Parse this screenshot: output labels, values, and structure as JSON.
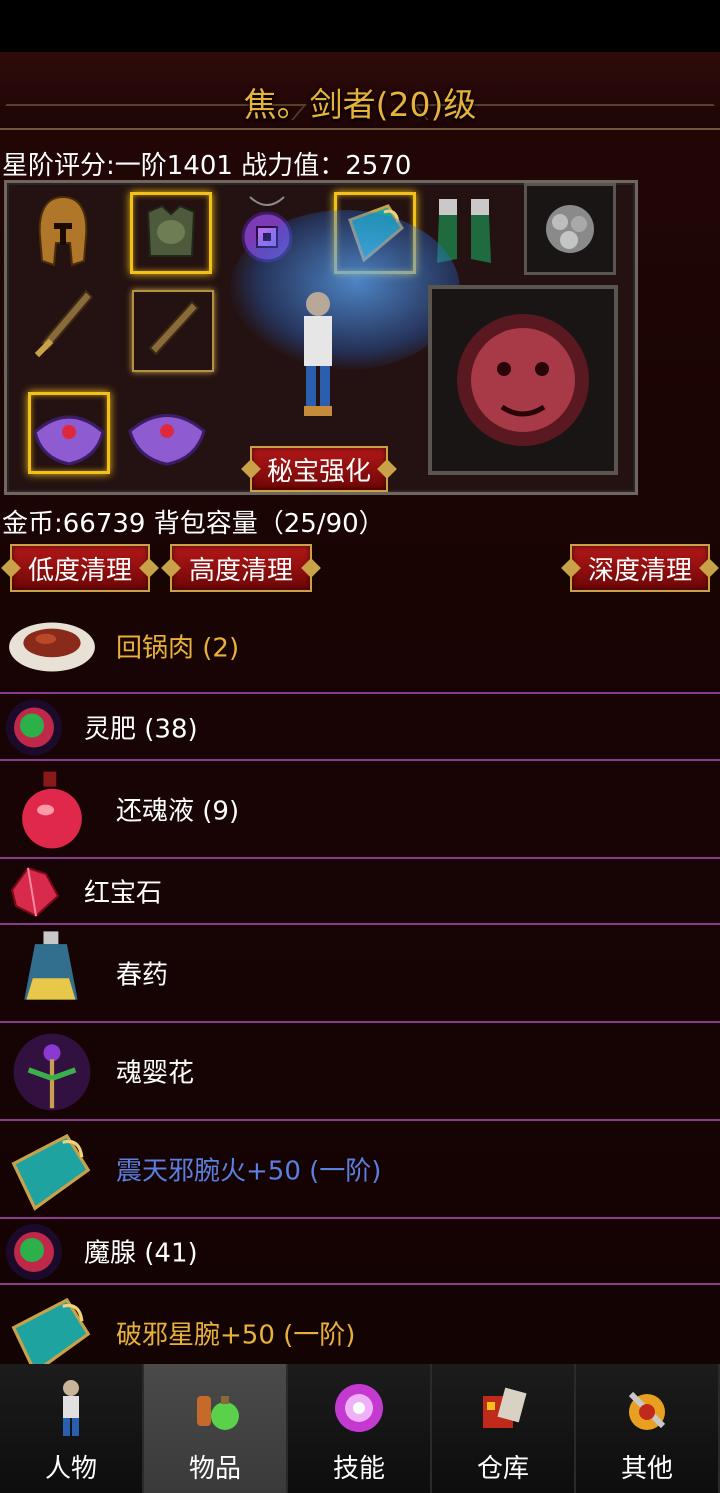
{
  "header": {
    "title": "焦。剑者(20)级"
  },
  "stats": {
    "rating_text": "星阶评分:一阶1401 战力值：2570"
  },
  "equipment": {
    "enhance_button": "秘宝强化"
  },
  "inventory": {
    "summary": "金币:66739 背包容量（25/90）",
    "clean_low": "低度清理",
    "clean_high": "高度清理",
    "clean_deep": "深度清理",
    "items": [
      {
        "name": "回锅肉 (2)",
        "color": "#e8b23a",
        "icon": "braised-pork-icon"
      },
      {
        "name": "灵肥 (38)",
        "color": "#ffffff",
        "icon": "green-orb-icon"
      },
      {
        "name": "还魂液 (9)",
        "color": "#ffffff",
        "icon": "red-potion-icon"
      },
      {
        "name": "红宝石",
        "color": "#ffffff",
        "icon": "ruby-icon"
      },
      {
        "name": "春药",
        "color": "#ffffff",
        "icon": "bottle-icon"
      },
      {
        "name": "魂婴花",
        "color": "#ffffff",
        "icon": "flower-icon"
      },
      {
        "name": "震天邪腕火+50 (一阶)",
        "color": "#5b7fe0",
        "icon": "bracer-icon"
      },
      {
        "name": "魔腺 (41)",
        "color": "#ffffff",
        "icon": "green-orb-icon"
      },
      {
        "name": "破邪星腕+50 (一阶)",
        "color": "#e8b23a",
        "icon": "bracer-icon"
      }
    ]
  },
  "nav": {
    "tabs": [
      {
        "label": "人物",
        "icon": "character-icon"
      },
      {
        "label": "物品",
        "icon": "items-icon"
      },
      {
        "label": "技能",
        "icon": "skills-icon"
      },
      {
        "label": "仓库",
        "icon": "warehouse-icon"
      },
      {
        "label": "其他",
        "icon": "other-icon"
      }
    ],
    "active": "物品"
  }
}
